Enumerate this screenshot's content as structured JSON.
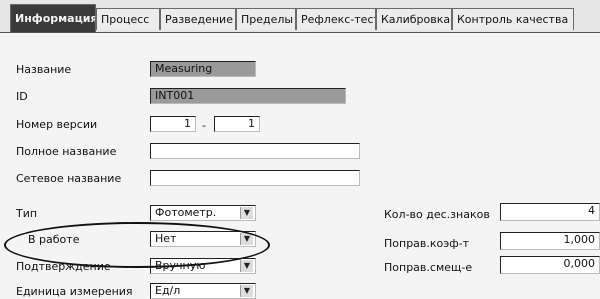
{
  "tabs": [
    {
      "label": "Информация",
      "active": true
    },
    {
      "label": "Процесс",
      "active": false
    },
    {
      "label": "Разведение",
      "active": false
    },
    {
      "label": "Пределы",
      "active": false
    },
    {
      "label": "Рефлекс-тест",
      "active": false
    },
    {
      "label": "Калибровка",
      "active": false
    },
    {
      "label": "Контроль качества",
      "active": false
    }
  ],
  "form": {
    "name": {
      "label": "Название",
      "value": "Measuring"
    },
    "id": {
      "label": "ID",
      "value": "INT001"
    },
    "version": {
      "label": "Номер версии",
      "major": "1",
      "separator": "-",
      "minor": "1"
    },
    "full_name": {
      "label": "Полное название",
      "value": ""
    },
    "network_name": {
      "label": "Сетевое название",
      "value": ""
    },
    "type": {
      "label": "Тип",
      "value": "Фотометр."
    },
    "in_work": {
      "label": "В работе",
      "value": "Нет"
    },
    "confirmation": {
      "label": "Подтверждение",
      "value": "Вручную"
    },
    "unit": {
      "label": "Единица измерения",
      "value": "Ед/л"
    }
  },
  "right": {
    "decimals": {
      "label": "Кол-во дес.знаков",
      "value": "4"
    },
    "corr_coef": {
      "label": "Поправ.коэф-т",
      "value": "1,000"
    },
    "corr_shift": {
      "label": "Поправ.смещ-е",
      "value": "0,000"
    }
  },
  "icons": {
    "dropdown": "chevron-down-icon"
  },
  "colors": {
    "active_tab": "#3a3a3a",
    "grey_field": "#9a9a9a",
    "highlight_oval": "#111111"
  }
}
